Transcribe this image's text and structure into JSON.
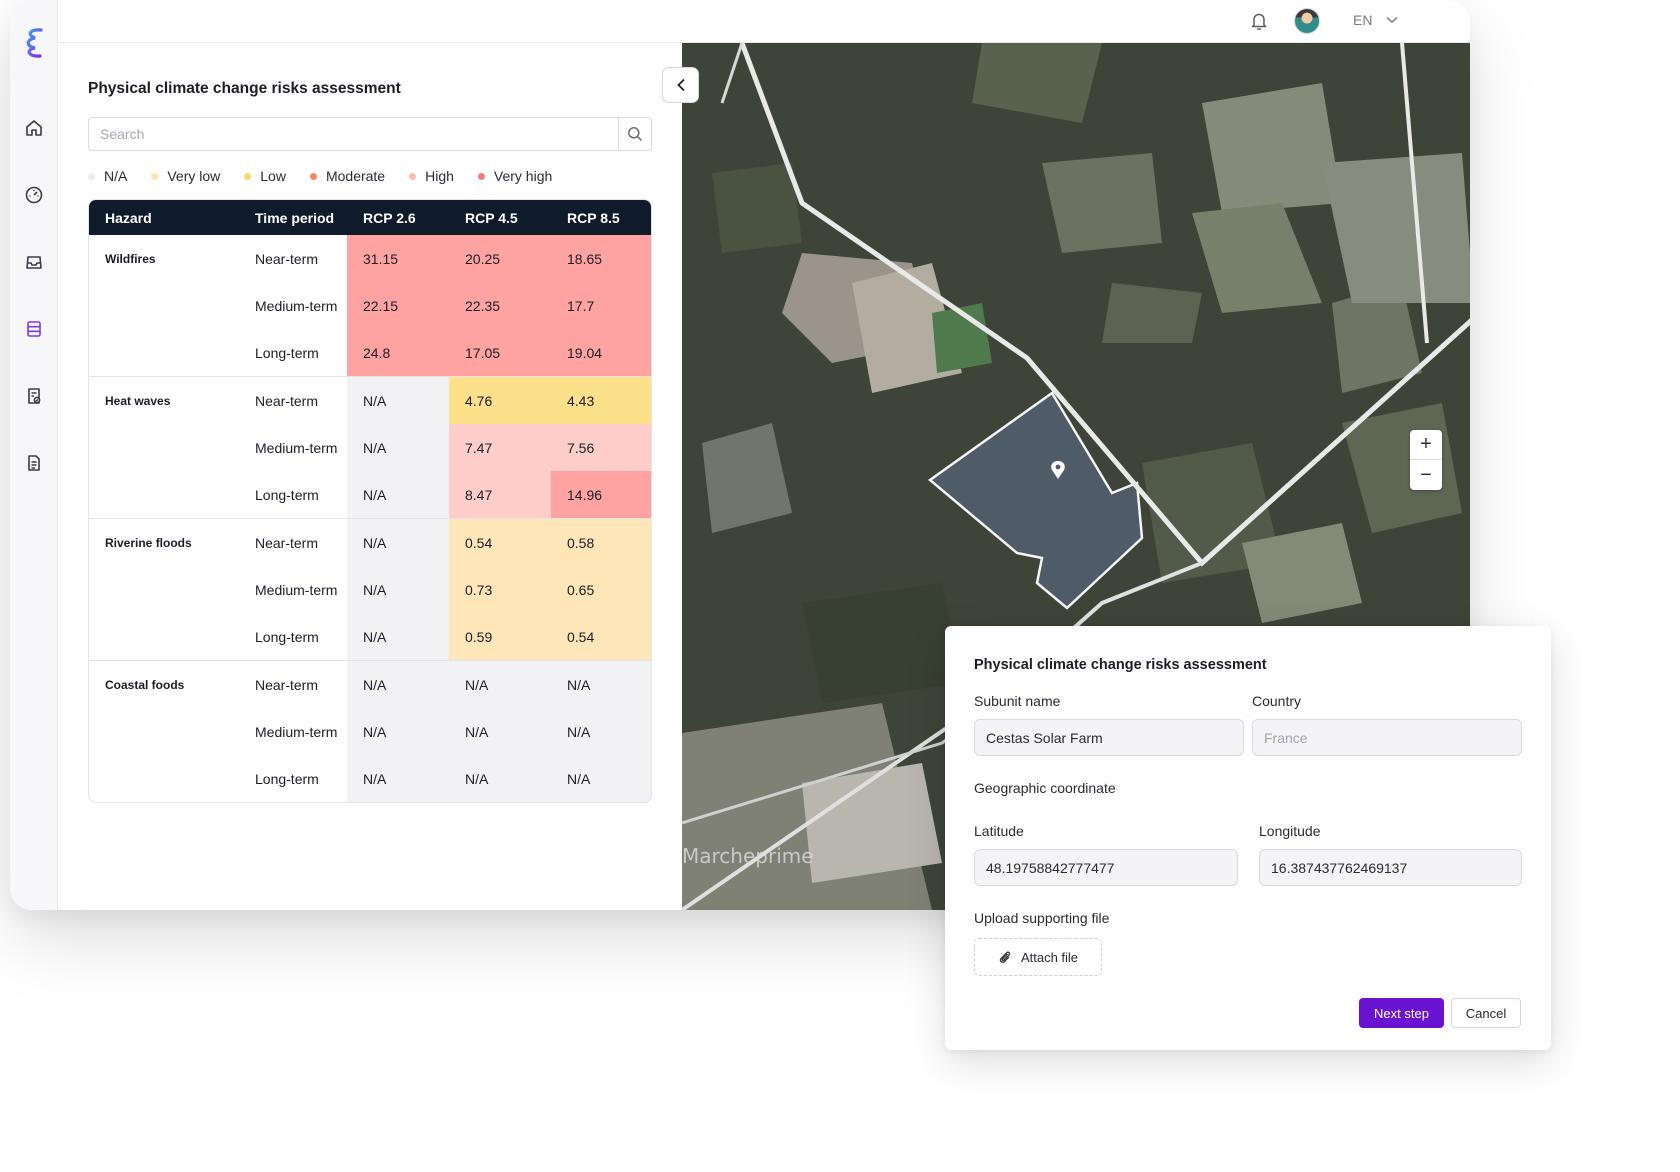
{
  "header": {
    "language": "EN"
  },
  "sidebar": {
    "icons": [
      "home-icon",
      "dashboard-gauge-icon",
      "inbox-icon",
      "database-icon",
      "report-check-icon",
      "document-icon"
    ],
    "active": "database-icon",
    "accent": "#7c3aed"
  },
  "panel": {
    "title": "Physical climate change risks assessment",
    "search_placeholder": "Search",
    "legend": [
      {
        "label": "N/A",
        "color": "#eeeeee"
      },
      {
        "label": "Very low",
        "color": "#fde7ad"
      },
      {
        "label": "Low",
        "color": "#fbd96a"
      },
      {
        "label": "Moderate",
        "color": "#f4895f"
      },
      {
        "label": "High",
        "color": "#fbbcb8"
      },
      {
        "label": "Very high",
        "color": "#f27b81"
      }
    ]
  },
  "table": {
    "headers": [
      "Hazard",
      "Time period",
      "RCP 2.6",
      "RCP 4.5",
      "RCP 8.5"
    ],
    "groups": [
      {
        "hazard": "Wildfires",
        "rows": [
          {
            "period": "Near-term",
            "values": [
              "31.15",
              "20.25",
              "18.65"
            ],
            "colors": [
              "#fea3a1",
              "#fea3a1",
              "#fea3a1"
            ]
          },
          {
            "period": "Medium-term",
            "values": [
              "22.15",
              "22.35",
              "17.7"
            ],
            "colors": [
              "#fea3a1",
              "#fea3a1",
              "#fea3a1"
            ]
          },
          {
            "period": "Long-term",
            "values": [
              "24.8",
              "17.05",
              "19.04"
            ],
            "colors": [
              "#fea3a1",
              "#fea3a1",
              "#fea3a1"
            ]
          }
        ]
      },
      {
        "hazard": "Heat waves",
        "rows": [
          {
            "period": "Near-term",
            "values": [
              "N/A",
              "4.76",
              "4.43"
            ],
            "colors": [
              "#f2f2f4",
              "#fce08a",
              "#fce08a"
            ]
          },
          {
            "period": "Medium-term",
            "values": [
              "N/A",
              "7.47",
              "7.56"
            ],
            "colors": [
              "#f2f2f4",
              "#fdcdca",
              "#fdcdca"
            ]
          },
          {
            "period": "Long-term",
            "values": [
              "N/A",
              "8.47",
              "14.96"
            ],
            "colors": [
              "#f2f2f4",
              "#fdcdca",
              "#fea3a1"
            ]
          }
        ]
      },
      {
        "hazard": "Riverine floods",
        "rows": [
          {
            "period": "Near-term",
            "values": [
              "N/A",
              "0.54",
              "0.58"
            ],
            "colors": [
              "#f2f2f4",
              "#fee6b8",
              "#fee6b8"
            ]
          },
          {
            "period": "Medium-term",
            "values": [
              "N/A",
              "0.73",
              "0.65"
            ],
            "colors": [
              "#f2f2f4",
              "#fee6b8",
              "#fee6b8"
            ]
          },
          {
            "period": "Long-term",
            "values": [
              "N/A",
              "0.59",
              "0.54"
            ],
            "colors": [
              "#f2f2f4",
              "#fee6b8",
              "#fee6b8"
            ]
          }
        ]
      },
      {
        "hazard": "Coastal foods",
        "rows": [
          {
            "period": "Near-term",
            "values": [
              "N/A",
              "N/A",
              "N/A"
            ],
            "colors": [
              "#f2f2f4",
              "#f2f2f4",
              "#f2f2f4"
            ]
          },
          {
            "period": "Medium-term",
            "values": [
              "N/A",
              "N/A",
              "N/A"
            ],
            "colors": [
              "#f2f2f4",
              "#f2f2f4",
              "#f2f2f4"
            ]
          },
          {
            "period": "Long-term",
            "values": [
              "N/A",
              "N/A",
              "N/A"
            ],
            "colors": [
              "#f2f2f4",
              "#f2f2f4",
              "#f2f2f4"
            ]
          }
        ]
      }
    ]
  },
  "map": {
    "place_label": "Marcheprime",
    "zoom_in": "+",
    "zoom_out": "−"
  },
  "modal": {
    "title": "Physical climate change risks assessment",
    "subunit_label": "Subunit name",
    "subunit_value": "Cestas Solar Farm",
    "country_label": "Country",
    "country_placeholder": "France",
    "geo_label": "Geographic coordinate",
    "lat_label": "Latitude",
    "lat_value": "48.19758842777477",
    "lon_label": "Longitude",
    "lon_value": "16.387437762469137",
    "upload_label": "Upload supporting file",
    "attach_label": "Attach file",
    "next_label": "Next step",
    "cancel_label": "Cancel",
    "primary_color": "#6a14d1"
  }
}
